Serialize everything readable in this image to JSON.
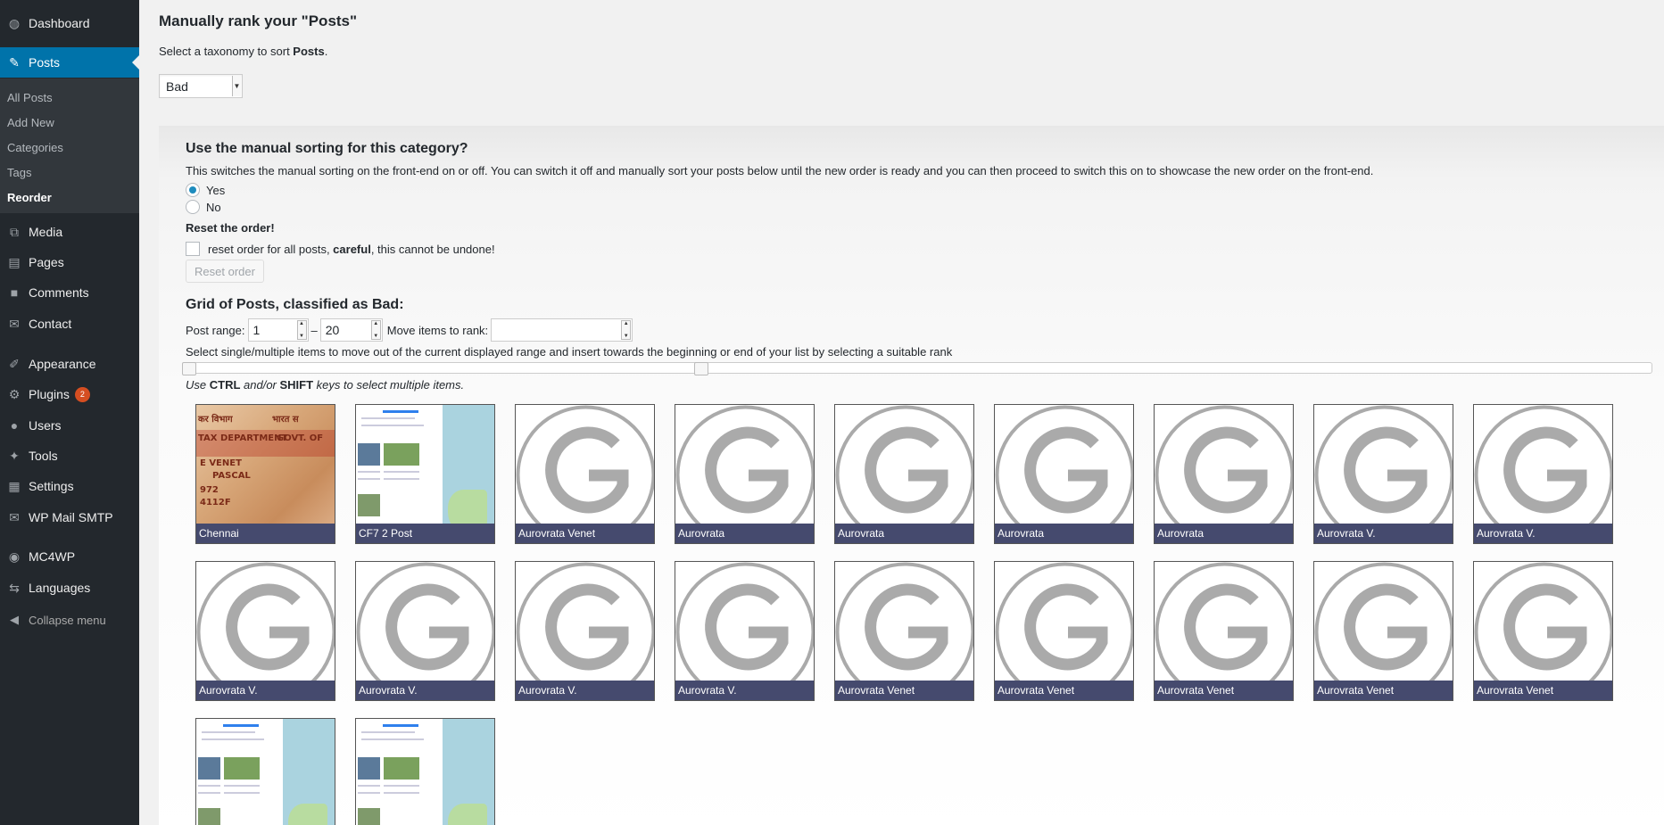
{
  "sidebar": {
    "items": [
      {
        "label": "Dashboard",
        "icon": "dashboard-icon"
      },
      {
        "label": "Posts",
        "icon": "pin-icon",
        "current": true
      },
      {
        "label": "Media",
        "icon": "media-icon"
      },
      {
        "label": "Pages",
        "icon": "pages-icon"
      },
      {
        "label": "Comments",
        "icon": "comments-icon"
      },
      {
        "label": "Contact",
        "icon": "mail-icon"
      },
      {
        "label": "Appearance",
        "icon": "brush-icon"
      },
      {
        "label": "Plugins",
        "icon": "plugin-icon",
        "badge": "2"
      },
      {
        "label": "Users",
        "icon": "users-icon"
      },
      {
        "label": "Tools",
        "icon": "wrench-icon"
      },
      {
        "label": "Settings",
        "icon": "settings-icon"
      },
      {
        "label": "WP Mail SMTP",
        "icon": "mail-icon"
      },
      {
        "label": "MC4WP",
        "icon": "mc4wp-icon"
      },
      {
        "label": "Languages",
        "icon": "languages-icon"
      },
      {
        "label": "Collapse menu",
        "icon": "collapse-icon"
      }
    ],
    "submenu": [
      "All Posts",
      "Add New",
      "Categories",
      "Tags",
      "Reorder"
    ]
  },
  "header": {
    "title": "Manually rank your \"Posts\"",
    "intro_prefix": "Select a taxonomy to sort ",
    "intro_bold": "Posts",
    "intro_suffix": "."
  },
  "taxonomy_select": {
    "value": "Bad"
  },
  "manual_sorting": {
    "heading": "Use the manual sorting for this category?",
    "description": "This switches the manual sorting on the front-end on or off. You can switch it off and manually sort your posts below until the new order is ready and you can then proceed to switch this on to showcase the new order on the front-end.",
    "yes_label": "Yes",
    "no_label": "No",
    "selected": "Yes"
  },
  "reset": {
    "title": "Reset the order!",
    "checkbox_prefix": "reset order for all posts, ",
    "checkbox_bold": "careful",
    "checkbox_suffix": ", this cannot be undone!",
    "button": "Reset order"
  },
  "grid": {
    "title": "Grid of Posts, classified as Bad:",
    "post_range_label": "Post range:",
    "range_from": "1",
    "range_sep": "–",
    "range_to": "20",
    "move_label": "Move items to rank:",
    "move_value": "",
    "select_help": "Select single/multiple items to move out of the current displayed range and insert towards the beginning or end of your list by selecting a suitable rank",
    "keys_help_use": "Use ",
    "keys_help_ctrl": "CTRL",
    "keys_help_andor": " and/or ",
    "keys_help_shift": "SHIFT",
    "keys_help_tail": " keys to select multiple items.",
    "posts": [
      {
        "caption": "Chennai",
        "thumb": "pan-card"
      },
      {
        "caption": "CF7 2 Post",
        "thumb": "map-screenshot"
      },
      {
        "caption": "Aurovrata Venet",
        "thumb": "gravatar"
      },
      {
        "caption": "Aurovrata",
        "thumb": "gravatar"
      },
      {
        "caption": "Aurovrata",
        "thumb": "gravatar"
      },
      {
        "caption": "Aurovrata",
        "thumb": "gravatar"
      },
      {
        "caption": "Aurovrata",
        "thumb": "gravatar"
      },
      {
        "caption": "Aurovrata V.",
        "thumb": "gravatar"
      },
      {
        "caption": "Aurovrata V.",
        "thumb": "gravatar"
      },
      {
        "caption": "Aurovrata V.",
        "thumb": "gravatar"
      },
      {
        "caption": "Aurovrata V.",
        "thumb": "gravatar"
      },
      {
        "caption": "Aurovrata V.",
        "thumb": "gravatar"
      },
      {
        "caption": "Aurovrata V.",
        "thumb": "gravatar"
      },
      {
        "caption": "Aurovrata Venet",
        "thumb": "gravatar"
      },
      {
        "caption": "Aurovrata Venet",
        "thumb": "gravatar"
      },
      {
        "caption": "Aurovrata Venet",
        "thumb": "gravatar"
      },
      {
        "caption": "Aurovrata Venet",
        "thumb": "gravatar"
      },
      {
        "caption": "Aurovrata Venet",
        "thumb": "gravatar"
      },
      {
        "caption": "",
        "thumb": "map-screenshot"
      },
      {
        "caption": "",
        "thumb": "map-screenshot"
      }
    ],
    "pan_card_text": [
      "कर विभाग",
      "भारत स",
      "TAX DEPARTMENT",
      "GOVT. OF",
      "E VENET",
      "PASCAL",
      "972",
      "4112F"
    ]
  }
}
